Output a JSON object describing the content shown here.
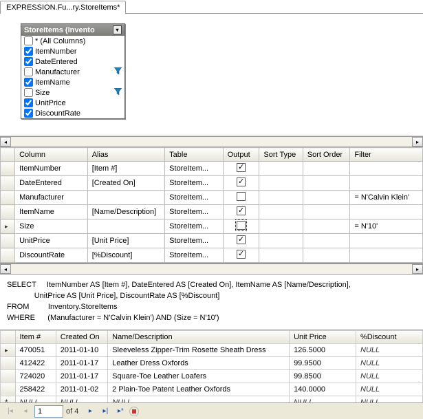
{
  "tab": {
    "title": "EXPRESSION.Fu...ry.StoreItems*"
  },
  "tableBox": {
    "title": "StoreItems (Invento",
    "columns": [
      {
        "label": "* (All Columns)",
        "checked": false,
        "filter": false
      },
      {
        "label": "ItemNumber",
        "checked": true,
        "filter": false
      },
      {
        "label": "DateEntered",
        "checked": true,
        "filter": false
      },
      {
        "label": "Manufacturer",
        "checked": false,
        "filter": true
      },
      {
        "label": "ItemName",
        "checked": true,
        "filter": false
      },
      {
        "label": "Size",
        "checked": false,
        "filter": true
      },
      {
        "label": "UnitPrice",
        "checked": true,
        "filter": false
      },
      {
        "label": "DiscountRate",
        "checked": true,
        "filter": false
      }
    ]
  },
  "criteria": {
    "headers": [
      "Column",
      "Alias",
      "Table",
      "Output",
      "Sort Type",
      "Sort Order",
      "Filter"
    ],
    "rows": [
      {
        "column": "ItemNumber",
        "alias": "[Item #]",
        "table": "StoreItem...",
        "output": true,
        "sortType": "",
        "sortOrder": "",
        "filter": "",
        "selected": false
      },
      {
        "column": "DateEntered",
        "alias": "[Created On]",
        "table": "StoreItem...",
        "output": true,
        "sortType": "",
        "sortOrder": "",
        "filter": "",
        "selected": false
      },
      {
        "column": "Manufacturer",
        "alias": "",
        "table": "StoreItem...",
        "output": false,
        "sortType": "",
        "sortOrder": "",
        "filter": "= N'Calvin Klein'",
        "selected": false
      },
      {
        "column": "ItemName",
        "alias": "[Name/Description]",
        "table": "StoreItem...",
        "output": true,
        "sortType": "",
        "sortOrder": "",
        "filter": "",
        "selected": false
      },
      {
        "column": "Size",
        "alias": "",
        "table": "StoreItem...",
        "output": false,
        "sortType": "",
        "sortOrder": "",
        "filter": "= N'10'",
        "selected": true,
        "dotted": true
      },
      {
        "column": "UnitPrice",
        "alias": "[Unit Price]",
        "table": "StoreItem...",
        "output": true,
        "sortType": "",
        "sortOrder": "",
        "filter": "",
        "selected": false
      },
      {
        "column": "DiscountRate",
        "alias": "[%Discount]",
        "table": "StoreItem...",
        "output": true,
        "sortType": "",
        "sortOrder": "",
        "filter": "",
        "selected": false
      }
    ]
  },
  "sql": {
    "select": "SELECT",
    "selectBody": "ItemNumber AS [Item #], DateEntered AS [Created On], ItemName AS [Name/Description],\n             UnitPrice AS [Unit Price], DiscountRate AS [%Discount]",
    "from": "FROM",
    "fromBody": "Inventory.StoreItems",
    "where": "WHERE",
    "whereBody": "(Manufacturer = N'Calvin Klein') AND (Size = N'10')"
  },
  "results": {
    "headers": [
      "Item #",
      "Created On",
      "Name/Description",
      "Unit Price",
      "%Discount"
    ],
    "rows": [
      {
        "cells": [
          "470051",
          "2011-01-10",
          "Sleeveless Zipper-Trim Rosette Sheath Dress",
          "126.5000",
          "NULL"
        ],
        "selected": true
      },
      {
        "cells": [
          "412422",
          "2011-01-17",
          "Leather Dress Oxfords",
          "99.9500",
          "NULL"
        ],
        "selected": false
      },
      {
        "cells": [
          "724020",
          "2011-01-17",
          "Square-Toe Leather Loafers",
          "99.8500",
          "NULL"
        ],
        "selected": false
      },
      {
        "cells": [
          "258422",
          "2011-01-02",
          "2 Plain-Toe Patent Leather Oxfords",
          "140.0000",
          "NULL"
        ],
        "selected": false
      }
    ],
    "newRow": [
      "NULL",
      "NULL",
      "NULL",
      "NULL",
      "NULL"
    ]
  },
  "nav": {
    "current": "1",
    "ofLabel": "of 4"
  }
}
